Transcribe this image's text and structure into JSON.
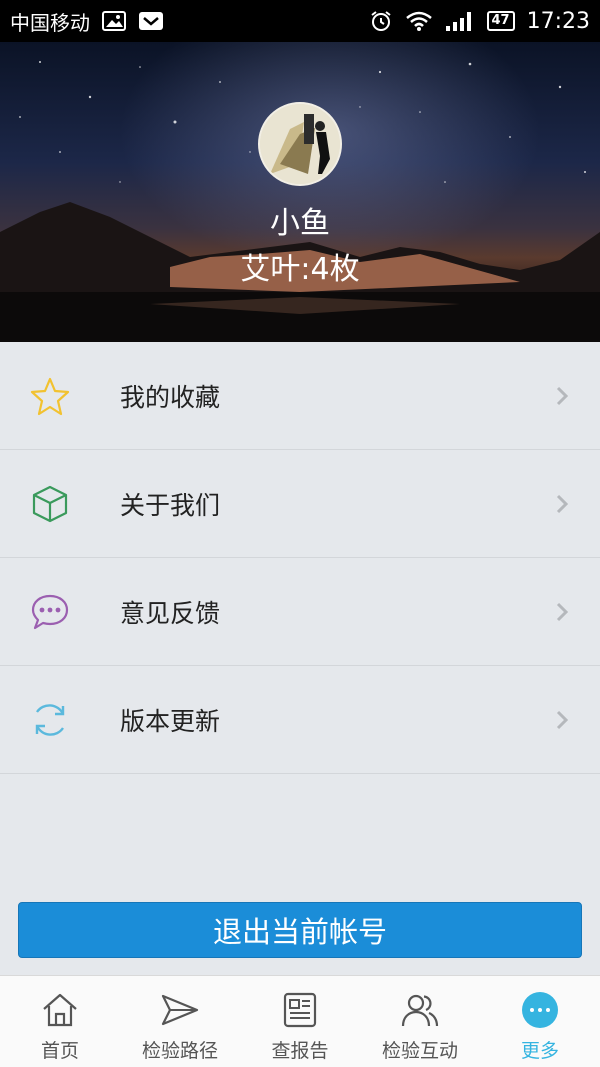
{
  "status_bar": {
    "carrier": "中国移动",
    "battery": "47",
    "time": "17:23"
  },
  "profile": {
    "username": "小鱼",
    "points": "艾叶:4枚"
  },
  "menu": {
    "items": [
      {
        "label": "我的收藏",
        "icon": "star-icon",
        "color": "#f2c230"
      },
      {
        "label": "关于我们",
        "icon": "cube-icon",
        "color": "#3a9a5c"
      },
      {
        "label": "意见反馈",
        "icon": "chat-bubble-icon",
        "color": "#9b5fb0"
      },
      {
        "label": "版本更新",
        "icon": "refresh-icon",
        "color": "#5bb9dd"
      }
    ]
  },
  "logout": {
    "label": "退出当前帐号",
    "color": "#1b8dd8"
  },
  "tabs": [
    {
      "label": "首页",
      "icon": "home-icon",
      "active": false
    },
    {
      "label": "检验路径",
      "icon": "send-icon",
      "active": false
    },
    {
      "label": "查报告",
      "icon": "report-icon",
      "active": false
    },
    {
      "label": "检验互动",
      "icon": "users-icon",
      "active": false
    },
    {
      "label": "更多",
      "icon": "more-icon",
      "active": true
    }
  ],
  "colors": {
    "active_tab": "#35b4e0",
    "chevron": "#b5b8bc"
  }
}
